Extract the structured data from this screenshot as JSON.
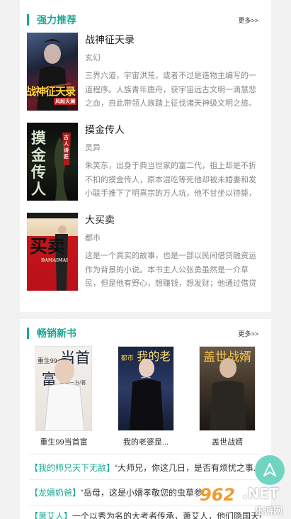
{
  "recommend": {
    "title": "强力推荐",
    "more": "更多>>",
    "books": [
      {
        "title": "战神征天录",
        "genre": "玄幻",
        "desc": "三界六道，宇宙洪荒，或者不过是造物主编写的一道程序。人族青年唐舟，获宇宙远古文明一滴慧悲之血，自此带领人族踏上征伐诸天神级文明之旅。",
        "cover_text": "战神征天录",
        "cover_badge": "风起天澜"
      },
      {
        "title": "摸金传人",
        "genre": "灵异",
        "desc": "朱笑东，出身于典当世家的富二代，祖上却是不折不扣的摸金传人，原本混吃等死他却被未婚妻和发小联手推下了明熹宗的万人坑，他不甘坐以待毙，",
        "cover_text": "摸金传人",
        "cover_badge": "古人诗匠"
      },
      {
        "title": "大买卖",
        "genre": "都市",
        "desc": "这是一个真实的故事，也是一部以民间借贷融资运作为背景的小说。本书主人公张勇虽然是一介草民，但是他有野心，想赚钱，想发财；他通过借贷",
        "cover_text": "买卖",
        "cover_badge": "DAMAIMAI"
      }
    ]
  },
  "new_books": {
    "title": "畅销新书",
    "more": "更多>>",
    "books": [
      {
        "title": "重生99当首富",
        "cover_text": "当首富",
        "cover_sub": "重生99",
        "cover_author": "富甲一方/著"
      },
      {
        "title": "我的老婆是...",
        "cover_text": "我的老婆",
        "cover_sub": "都市"
      },
      {
        "title": "盖世战婿",
        "cover_text": "盖世战婿"
      }
    ],
    "excerpts": [
      {
        "tag": "【我的师兄天下无敌】",
        "text": "“大师兄，你这几日，是否有烦忧之事..."
      },
      {
        "tag": "【龙婿奶爸】",
        "text": "“岳母，这是小婿孝敬您的虫草参..."
      },
      {
        "tag": "【萧艾人】",
        "text": "一个以秀为名的大考者传承，萧艾人，他们隐国天英..."
      }
    ]
  },
  "watermark": {
    "num": "962",
    "net": ".NET",
    "sub": "乐游网"
  },
  "colors": {
    "accent": "#1ba894",
    "fab": "#6fd5c0",
    "background": "#f2f2f2"
  },
  "icons": {
    "fab": "navigation-arrow-icon"
  }
}
